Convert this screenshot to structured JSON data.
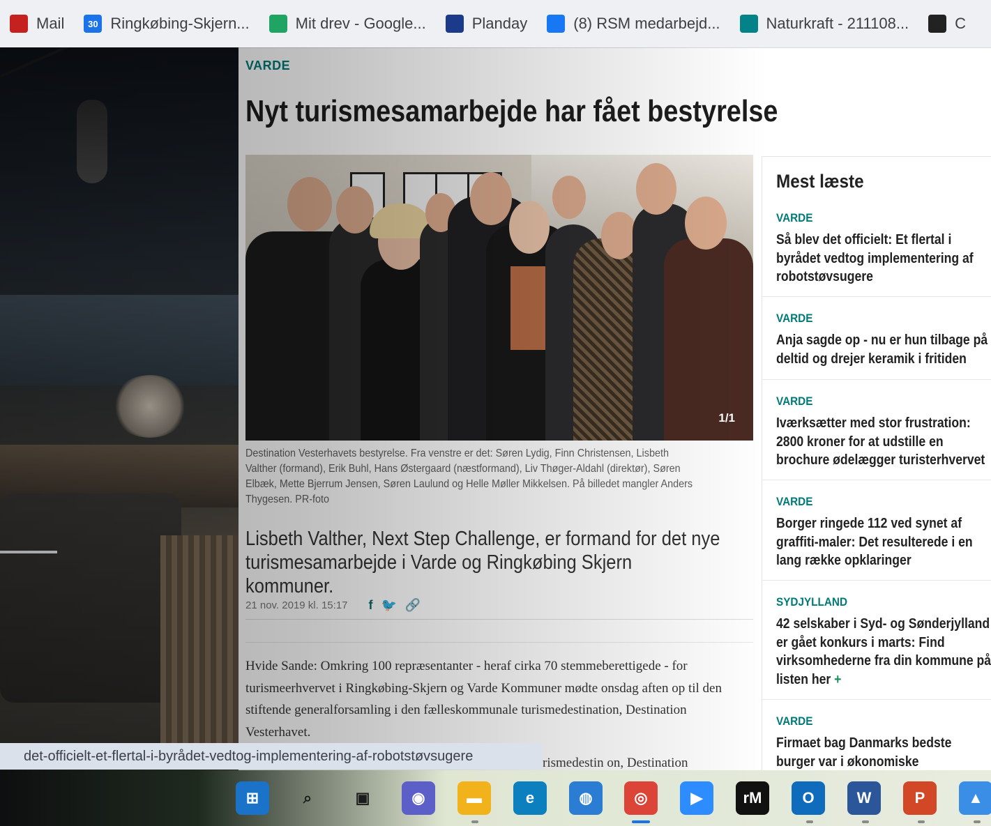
{
  "bookmarks": [
    {
      "label": "Mail",
      "icon": "gmail-icon",
      "color": "#c5221f"
    },
    {
      "label": "Ringkøbing-Skjern...",
      "icon": "calendar-icon",
      "color": "#1a73e8",
      "glyph": "30"
    },
    {
      "label": "Mit drev - Google...",
      "icon": "google-drive-icon",
      "color": "#1fa463"
    },
    {
      "label": "Planday",
      "icon": "planday-icon",
      "color": "#1b3a8a"
    },
    {
      "label": "(8) RSM medarbejd...",
      "icon": "facebook-icon",
      "color": "#1877f2"
    },
    {
      "label": "Naturkraft - 211108...",
      "icon": "sharepoint-icon",
      "color": "#038387"
    },
    {
      "label": "C",
      "icon": "cobe-icon",
      "color": "#222222"
    }
  ],
  "article": {
    "section": "VARDE",
    "headline": "Nyt turismesamarbejde har fået bestyrelse",
    "image_counter": "1/1",
    "caption": "Destination Vesterhavets bestyrelse. Fra venstre er det: Søren Lydig, Finn Christensen, Lisbeth Valther (formand), Erik Buhl, Hans Østergaard (næstformand), Liv Thøger-Aldahl (direktør), Søren Elbæk, Mette Bjerrum Jensen, Søren Laulund og Helle Møller Mikkelsen. På billedet mangler Anders Thygesen. PR-foto",
    "lead": "Lisbeth Valther, Next Step Challenge, er formand for det nye turismesamarbejde i Varde og Ringkøbing Skjern kommuner.",
    "date": "21 nov. 2019 kl. 15:17",
    "share": {
      "facebook": "f",
      "twitter": "🐦",
      "link": "🔗"
    },
    "body": "Hvide Sande: Omkring 100 repræsentanter - heraf cirka 70 stemmeberettigede - for turismeerhvervet i Ringkøbing-Skjern og Varde Kommuner mødte onsdag aften op til den stiftende generalforsamling i den fælleskommunale turismedestination, Destination Vesterhavet.",
    "body_partial": "rismedestin   on, Destination"
  },
  "sidebar": {
    "title": "Mest læste",
    "items": [
      {
        "kicker": "VARDE",
        "headline_lines": [
          "Så blev det officielt: Et flertal i",
          "byrådet vedtog implementering af",
          "robotstøvsugere"
        ]
      },
      {
        "kicker": "VARDE",
        "headline_lines": [
          "Anja sagde op - nu er hun tilbage på",
          "deltid og drejer keramik i fritiden"
        ]
      },
      {
        "kicker": "VARDE",
        "headline_lines": [
          "Iværksætter med stor frustration:",
          "2800 kroner for at udstille en",
          "brochure ødelægger turisterhvervet"
        ]
      },
      {
        "kicker": "VARDE",
        "headline_lines": [
          "Borger ringede 112 ved synet af",
          "graffiti-maler: Det resulterede i en",
          "lang række opklaringer"
        ]
      },
      {
        "kicker": "SYDJYLLAND",
        "headline_lines": [
          "42 selskaber i Syd- og Sønderjylland",
          "er gået konkurs i marts: Find",
          "virksomhederne fra din kommune på",
          "listen her"
        ],
        "plus": "+"
      },
      {
        "kicker": "VARDE",
        "headline_lines": [
          "Firmaet bag Danmarks bedste",
          "burger var i økonomiske"
        ]
      }
    ]
  },
  "status_url": "det-officielt-et-flertal-i-byrådet-vedtog-implementering-af-robotstøvsugere",
  "taskbar": [
    {
      "name": "start-icon",
      "glyph": "⊞",
      "bg": "#1a73c9"
    },
    {
      "name": "search-icon",
      "glyph": "⌕",
      "bg": "transparent"
    },
    {
      "name": "task-view-icon",
      "glyph": "▣",
      "bg": "transparent"
    },
    {
      "name": "teams-chat-icon",
      "glyph": "◉",
      "bg": "#5b5fc7"
    },
    {
      "name": "file-explorer-icon",
      "glyph": "▬",
      "bg": "#f2b21b"
    },
    {
      "name": "edge-icon",
      "glyph": "e",
      "bg": "#0c7fbf"
    },
    {
      "name": "globe-app-icon",
      "glyph": "◍",
      "bg": "#2b7cd3"
    },
    {
      "name": "chrome-icon",
      "glyph": "◎",
      "bg": "#db4437"
    },
    {
      "name": "zoom-icon",
      "glyph": "▶",
      "bg": "#2d8cff"
    },
    {
      "name": "rm-app-icon",
      "glyph": "rM",
      "bg": "#111111"
    },
    {
      "name": "outlook-icon",
      "glyph": "O",
      "bg": "#0f6cbd"
    },
    {
      "name": "word-icon",
      "glyph": "W",
      "bg": "#2b579a"
    },
    {
      "name": "powerpoint-icon",
      "glyph": "P",
      "bg": "#d24726"
    },
    {
      "name": "photos-icon",
      "glyph": "▲",
      "bg": "#3a8ee6"
    }
  ],
  "colors": {
    "accent": "#007a78",
    "headline": "#1d1d1d"
  }
}
